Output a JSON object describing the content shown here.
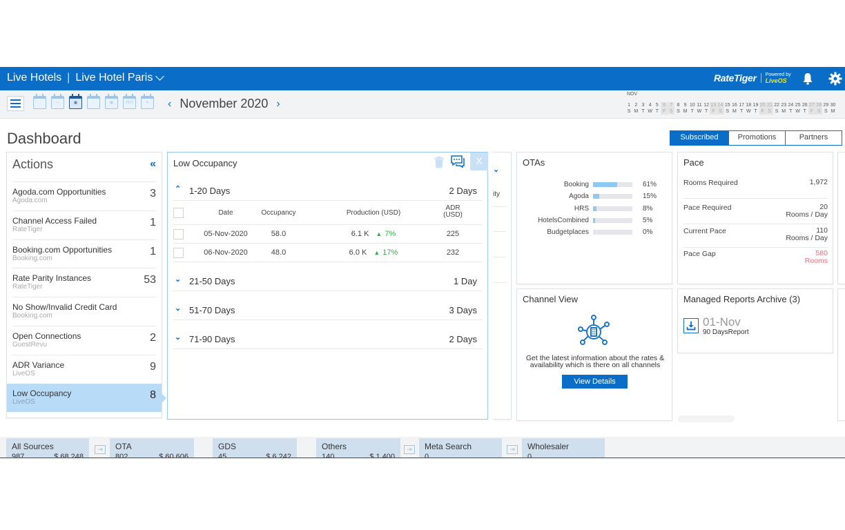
{
  "header": {
    "org": "Live Hotels",
    "hotel": "Live Hotel Paris",
    "logo_text": "RateTiger",
    "powered_by": "Powered by",
    "powered_brand": "LiveOS",
    "icons": [
      "bell-icon",
      "gear-icon"
    ]
  },
  "toolbar": {
    "menu_icon": "hamburger-icon",
    "calendar_views": [
      {
        "name": "day-view-icon",
        "glyph": "·",
        "active": false
      },
      {
        "name": "week-view-icon",
        "glyph": "—",
        "active": false
      },
      {
        "name": "month-view-icon",
        "glyph": "▦",
        "active": true
      },
      {
        "name": "multi-view-icon",
        "glyph": "⋯",
        "active": false
      },
      {
        "name": "grid-view-icon",
        "glyph": "▦",
        "active": false
      },
      {
        "name": "hot-dates-icon",
        "glyph": "HOT",
        "active": false
      },
      {
        "name": "edit-calendar-icon",
        "glyph": "✎",
        "active": false
      }
    ],
    "month_label": "November 2020",
    "prev": "‹",
    "next": "›"
  },
  "mini_calendar": {
    "month": "NOV",
    "days": [
      {
        "n": "1",
        "d": "S",
        "we": false
      },
      {
        "n": "2",
        "d": "M",
        "we": false
      },
      {
        "n": "3",
        "d": "T",
        "we": false
      },
      {
        "n": "4",
        "d": "W",
        "we": false
      },
      {
        "n": "5",
        "d": "T",
        "we": false
      },
      {
        "n": "6",
        "d": "F",
        "we": true
      },
      {
        "n": "7",
        "d": "S",
        "we": true
      },
      {
        "n": "8",
        "d": "S",
        "we": false
      },
      {
        "n": "9",
        "d": "M",
        "we": false
      },
      {
        "n": "10",
        "d": "T",
        "we": false
      },
      {
        "n": "11",
        "d": "W",
        "we": false
      },
      {
        "n": "12",
        "d": "T",
        "we": false
      },
      {
        "n": "13",
        "d": "F",
        "we": true
      },
      {
        "n": "14",
        "d": "S",
        "we": true
      },
      {
        "n": "15",
        "d": "S",
        "we": false
      },
      {
        "n": "16",
        "d": "M",
        "we": false
      },
      {
        "n": "17",
        "d": "T",
        "we": false
      },
      {
        "n": "18",
        "d": "W",
        "we": false
      },
      {
        "n": "19",
        "d": "T",
        "we": false
      },
      {
        "n": "20",
        "d": "F",
        "we": true
      },
      {
        "n": "21",
        "d": "S",
        "we": true
      },
      {
        "n": "22",
        "d": "S",
        "we": false
      },
      {
        "n": "23",
        "d": "M",
        "we": false
      },
      {
        "n": "24",
        "d": "T",
        "we": false
      },
      {
        "n": "25",
        "d": "W",
        "we": false
      },
      {
        "n": "26",
        "d": "T",
        "we": false
      },
      {
        "n": "27",
        "d": "F",
        "we": true
      },
      {
        "n": "28",
        "d": "S",
        "we": true
      },
      {
        "n": "29",
        "d": "S",
        "we": false
      },
      {
        "n": "30",
        "d": "M",
        "we": false
      }
    ]
  },
  "page": {
    "title": "Dashboard",
    "tabs": [
      {
        "label": "Subscribed",
        "active": true
      },
      {
        "label": "Promotions",
        "active": false
      },
      {
        "label": "Partners",
        "active": false
      }
    ]
  },
  "actions": {
    "title": "Actions",
    "collapse": "«",
    "items": [
      {
        "title": "Agoda.com Opportunities",
        "source": "Agoda.com",
        "count": "3",
        "selected": false
      },
      {
        "title": "Channel Access Failed",
        "source": "RateTiger",
        "count": "1",
        "selected": false
      },
      {
        "title": "Booking.com Opportunities",
        "source": "Booking.com",
        "count": "1",
        "selected": false
      },
      {
        "title": "Rate Parity Instances",
        "source": "RateTiger",
        "count": "53",
        "selected": false
      },
      {
        "title": "No Show/Invalid Credit Card",
        "source": "Booking.com",
        "count": "",
        "selected": false
      },
      {
        "title": "Open Connections",
        "source": "GuestRevu",
        "count": "2",
        "selected": false
      },
      {
        "title": "ADR Variance",
        "source": "LiveOS",
        "count": "9",
        "selected": false
      },
      {
        "title": "Low Occupancy",
        "source": "LiveOS",
        "count": "8",
        "selected": true
      }
    ]
  },
  "low_occupancy": {
    "title": "Low Occupancy",
    "close": "X",
    "groups": [
      {
        "label": "1-20 Days",
        "count": "2 Days",
        "expanded": true
      },
      {
        "label": "21-50 Days",
        "count": "1 Day",
        "expanded": false
      },
      {
        "label": "51-70 Days",
        "count": "3 Days",
        "expanded": false
      },
      {
        "label": "71-90 Days",
        "count": "2 Days",
        "expanded": false
      }
    ],
    "columns": {
      "date": "Date",
      "occupancy": "Occupancy",
      "production": "Production (USD)",
      "adr_line1": "ADR",
      "adr_line2": "(USD)"
    },
    "rows": [
      {
        "date": "05-Nov-2020",
        "occupancy": "58.0",
        "production": "6.1 K",
        "change": "7%",
        "adr": "225"
      },
      {
        "date": "06-Nov-2020",
        "occupancy": "48.0",
        "production": "6.0 K",
        "change": "17%",
        "adr": "232"
      }
    ]
  },
  "partial_panel": {
    "text": "ity"
  },
  "otas": {
    "title": "OTAs",
    "items": [
      {
        "name": "Booking",
        "value": "61%",
        "fraction": 0.61
      },
      {
        "name": "Agoda",
        "value": "15%",
        "fraction": 0.15
      },
      {
        "name": "HRS",
        "value": "8%",
        "fraction": 0.08
      },
      {
        "name": "HotelsCombined",
        "value": "5%",
        "fraction": 0.05
      },
      {
        "name": "Budgetplaces",
        "value": "0%",
        "fraction": 0.0
      }
    ]
  },
  "pace": {
    "title": "Pace",
    "rows": [
      {
        "label": "Rooms Required",
        "value": "1,972",
        "unit": ""
      },
      {
        "label": "Pace Required",
        "value": "20",
        "unit": "Rooms / Day"
      },
      {
        "label": "Current Pace",
        "value": "110",
        "unit": "Rooms / Day"
      },
      {
        "label": "Pace Gap",
        "value": "580",
        "unit": "Rooms",
        "alert": true
      }
    ],
    "alert_color": "#f06a7a"
  },
  "channel_view": {
    "title": "Channel View",
    "description": "Get the latest information about the rates & availability which is there on all channels",
    "button": "View Details"
  },
  "reports": {
    "title": "Managed Reports Archive (3)",
    "date": "01-Nov",
    "name": "90 DaysReport"
  },
  "sources": [
    {
      "name": "All Sources",
      "count": "987",
      "amount": "$ 68,248"
    },
    {
      "name": "OTA",
      "count": "802",
      "amount": "$ 60,606"
    },
    {
      "name": "GDS",
      "count": "45",
      "amount": "$ 6,242"
    },
    {
      "name": "Others",
      "count": "140",
      "amount": "$ 1,400"
    },
    {
      "name": "Meta Search",
      "count": "0",
      "amount": ""
    },
    {
      "name": "Wholesaler",
      "count": "0",
      "amount": ""
    }
  ],
  "colors": {
    "brand": "#0a6ec8",
    "selected": "#b8dcf8",
    "positive": "#2fb344",
    "alert": "#f06a7a"
  }
}
